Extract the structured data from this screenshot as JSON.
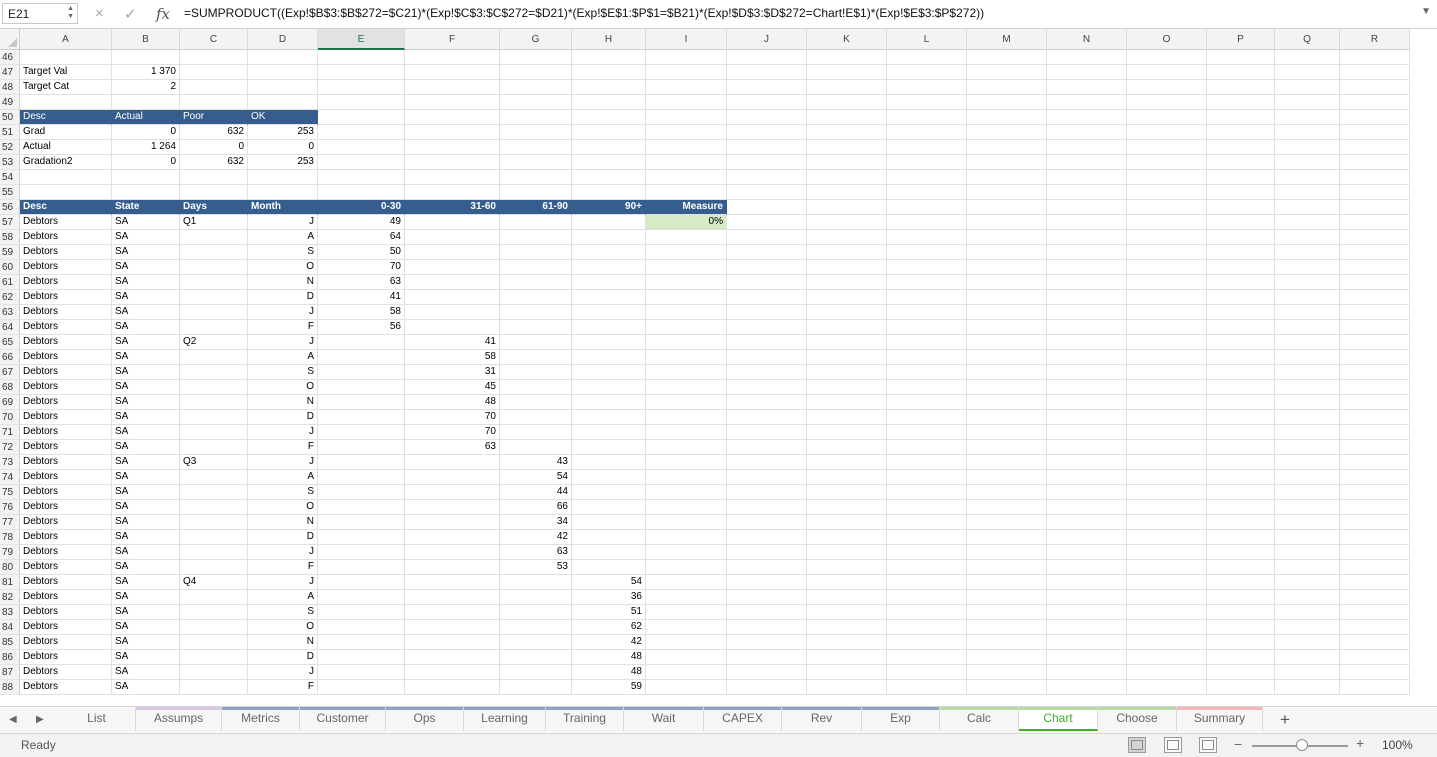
{
  "formula_bar": {
    "name_box": "E21",
    "cancel_icon": "×",
    "enter_icon": "✓",
    "fx_label": "fx",
    "formula": "=SUMPRODUCT((Exp!$B$3:$B$272=$C21)*(Exp!$C$3:$C$272=$D21)*(Exp!$E$1:$P$1=$B21)*(Exp!$D$3:$D$272=Chart!E$1)*(Exp!$E$3:$P$272))"
  },
  "columns": [
    "A",
    "B",
    "C",
    "D",
    "E",
    "F",
    "G",
    "H",
    "I",
    "J",
    "K",
    "L",
    "M",
    "N",
    "O",
    "P",
    "Q",
    "R"
  ],
  "selected_column": "E",
  "rows": [
    {
      "n": "46",
      "cells": []
    },
    {
      "n": "47",
      "cells": [
        {
          "col": "A",
          "v": "Target Val"
        },
        {
          "col": "B",
          "v": "1 370",
          "num": true
        }
      ]
    },
    {
      "n": "48",
      "cells": [
        {
          "col": "A",
          "v": "Target Cat"
        },
        {
          "col": "B",
          "v": "2",
          "num": true
        }
      ]
    },
    {
      "n": "49",
      "cells": []
    },
    {
      "n": "50",
      "cells": [
        {
          "col": "A",
          "v": "Desc",
          "style": "hdr2"
        },
        {
          "col": "B",
          "v": "Actual",
          "style": "hdr2"
        },
        {
          "col": "C",
          "v": "Poor",
          "style": "hdr2"
        },
        {
          "col": "D",
          "v": "OK",
          "style": "hdr2"
        }
      ]
    },
    {
      "n": "51",
      "cells": [
        {
          "col": "A",
          "v": "Grad"
        },
        {
          "col": "B",
          "v": "0",
          "num": true
        },
        {
          "col": "C",
          "v": "632",
          "num": true
        },
        {
          "col": "D",
          "v": "253",
          "num": true
        }
      ]
    },
    {
      "n": "52",
      "cells": [
        {
          "col": "A",
          "v": "Actual"
        },
        {
          "col": "B",
          "v": "1 264",
          "num": true
        },
        {
          "col": "C",
          "v": "0",
          "num": true
        },
        {
          "col": "D",
          "v": "0",
          "num": true
        }
      ]
    },
    {
      "n": "53",
      "cells": [
        {
          "col": "A",
          "v": "Gradation2"
        },
        {
          "col": "B",
          "v": "0",
          "num": true
        },
        {
          "col": "C",
          "v": "632",
          "num": true
        },
        {
          "col": "D",
          "v": "253",
          "num": true
        }
      ]
    },
    {
      "n": "54",
      "cells": []
    },
    {
      "n": "55",
      "cells": []
    },
    {
      "n": "56",
      "cells": [
        {
          "col": "A",
          "v": "Desc",
          "style": "hdr"
        },
        {
          "col": "B",
          "v": "State",
          "style": "hdr"
        },
        {
          "col": "C",
          "v": "Days",
          "style": "hdr"
        },
        {
          "col": "D",
          "v": "Month",
          "style": "hdr"
        },
        {
          "col": "E",
          "v": "0-30",
          "style": "hdr",
          "num": true
        },
        {
          "col": "F",
          "v": "31-60",
          "style": "hdr",
          "num": true
        },
        {
          "col": "G",
          "v": "61-90",
          "style": "hdr",
          "num": true
        },
        {
          "col": "H",
          "v": "90+",
          "style": "hdr",
          "num": true
        },
        {
          "col": "I",
          "v": "Measure",
          "style": "hdr",
          "num": true
        }
      ]
    },
    {
      "n": "57",
      "cells": [
        {
          "col": "A",
          "v": "Debtors"
        },
        {
          "col": "B",
          "v": "SA"
        },
        {
          "col": "C",
          "v": "Q1"
        },
        {
          "col": "D",
          "v": "J",
          "num": true
        },
        {
          "col": "E",
          "v": "49",
          "num": true
        },
        {
          "col": "I",
          "v": "0%",
          "num": true,
          "style": "meas"
        }
      ]
    },
    {
      "n": "58",
      "cells": [
        {
          "col": "A",
          "v": "Debtors"
        },
        {
          "col": "B",
          "v": "SA"
        },
        {
          "col": "D",
          "v": "A",
          "num": true
        },
        {
          "col": "E",
          "v": "64",
          "num": true
        }
      ]
    },
    {
      "n": "59",
      "cells": [
        {
          "col": "A",
          "v": "Debtors"
        },
        {
          "col": "B",
          "v": "SA"
        },
        {
          "col": "D",
          "v": "S",
          "num": true
        },
        {
          "col": "E",
          "v": "50",
          "num": true
        }
      ]
    },
    {
      "n": "60",
      "cells": [
        {
          "col": "A",
          "v": "Debtors"
        },
        {
          "col": "B",
          "v": "SA"
        },
        {
          "col": "D",
          "v": "O",
          "num": true
        },
        {
          "col": "E",
          "v": "70",
          "num": true
        }
      ]
    },
    {
      "n": "61",
      "cells": [
        {
          "col": "A",
          "v": "Debtors"
        },
        {
          "col": "B",
          "v": "SA"
        },
        {
          "col": "D",
          "v": "N",
          "num": true
        },
        {
          "col": "E",
          "v": "63",
          "num": true
        }
      ]
    },
    {
      "n": "62",
      "cells": [
        {
          "col": "A",
          "v": "Debtors"
        },
        {
          "col": "B",
          "v": "SA"
        },
        {
          "col": "D",
          "v": "D",
          "num": true
        },
        {
          "col": "E",
          "v": "41",
          "num": true
        }
      ]
    },
    {
      "n": "63",
      "cells": [
        {
          "col": "A",
          "v": "Debtors"
        },
        {
          "col": "B",
          "v": "SA"
        },
        {
          "col": "D",
          "v": "J",
          "num": true
        },
        {
          "col": "E",
          "v": "58",
          "num": true
        }
      ]
    },
    {
      "n": "64",
      "cells": [
        {
          "col": "A",
          "v": "Debtors"
        },
        {
          "col": "B",
          "v": "SA"
        },
        {
          "col": "D",
          "v": "F",
          "num": true
        },
        {
          "col": "E",
          "v": "56",
          "num": true
        }
      ]
    },
    {
      "n": "65",
      "cells": [
        {
          "col": "A",
          "v": "Debtors"
        },
        {
          "col": "B",
          "v": "SA"
        },
        {
          "col": "C",
          "v": "Q2"
        },
        {
          "col": "D",
          "v": "J",
          "num": true
        },
        {
          "col": "F",
          "v": "41",
          "num": true
        }
      ]
    },
    {
      "n": "66",
      "cells": [
        {
          "col": "A",
          "v": "Debtors"
        },
        {
          "col": "B",
          "v": "SA"
        },
        {
          "col": "D",
          "v": "A",
          "num": true
        },
        {
          "col": "F",
          "v": "58",
          "num": true
        }
      ]
    },
    {
      "n": "67",
      "cells": [
        {
          "col": "A",
          "v": "Debtors"
        },
        {
          "col": "B",
          "v": "SA"
        },
        {
          "col": "D",
          "v": "S",
          "num": true
        },
        {
          "col": "F",
          "v": "31",
          "num": true
        }
      ]
    },
    {
      "n": "68",
      "cells": [
        {
          "col": "A",
          "v": "Debtors"
        },
        {
          "col": "B",
          "v": "SA"
        },
        {
          "col": "D",
          "v": "O",
          "num": true
        },
        {
          "col": "F",
          "v": "45",
          "num": true
        }
      ]
    },
    {
      "n": "69",
      "cells": [
        {
          "col": "A",
          "v": "Debtors"
        },
        {
          "col": "B",
          "v": "SA"
        },
        {
          "col": "D",
          "v": "N",
          "num": true
        },
        {
          "col": "F",
          "v": "48",
          "num": true
        }
      ]
    },
    {
      "n": "70",
      "cells": [
        {
          "col": "A",
          "v": "Debtors"
        },
        {
          "col": "B",
          "v": "SA"
        },
        {
          "col": "D",
          "v": "D",
          "num": true
        },
        {
          "col": "F",
          "v": "70",
          "num": true
        }
      ]
    },
    {
      "n": "71",
      "cells": [
        {
          "col": "A",
          "v": "Debtors"
        },
        {
          "col": "B",
          "v": "SA"
        },
        {
          "col": "D",
          "v": "J",
          "num": true
        },
        {
          "col": "F",
          "v": "70",
          "num": true
        }
      ]
    },
    {
      "n": "72",
      "cells": [
        {
          "col": "A",
          "v": "Debtors"
        },
        {
          "col": "B",
          "v": "SA"
        },
        {
          "col": "D",
          "v": "F",
          "num": true
        },
        {
          "col": "F",
          "v": "63",
          "num": true
        }
      ]
    },
    {
      "n": "73",
      "cells": [
        {
          "col": "A",
          "v": "Debtors"
        },
        {
          "col": "B",
          "v": "SA"
        },
        {
          "col": "C",
          "v": "Q3"
        },
        {
          "col": "D",
          "v": "J",
          "num": true
        },
        {
          "col": "G",
          "v": "43",
          "num": true
        }
      ]
    },
    {
      "n": "74",
      "cells": [
        {
          "col": "A",
          "v": "Debtors"
        },
        {
          "col": "B",
          "v": "SA"
        },
        {
          "col": "D",
          "v": "A",
          "num": true
        },
        {
          "col": "G",
          "v": "54",
          "num": true
        }
      ]
    },
    {
      "n": "75",
      "cells": [
        {
          "col": "A",
          "v": "Debtors"
        },
        {
          "col": "B",
          "v": "SA"
        },
        {
          "col": "D",
          "v": "S",
          "num": true
        },
        {
          "col": "G",
          "v": "44",
          "num": true
        }
      ]
    },
    {
      "n": "76",
      "cells": [
        {
          "col": "A",
          "v": "Debtors"
        },
        {
          "col": "B",
          "v": "SA"
        },
        {
          "col": "D",
          "v": "O",
          "num": true
        },
        {
          "col": "G",
          "v": "66",
          "num": true
        }
      ]
    },
    {
      "n": "77",
      "cells": [
        {
          "col": "A",
          "v": "Debtors"
        },
        {
          "col": "B",
          "v": "SA"
        },
        {
          "col": "D",
          "v": "N",
          "num": true
        },
        {
          "col": "G",
          "v": "34",
          "num": true
        }
      ]
    },
    {
      "n": "78",
      "cells": [
        {
          "col": "A",
          "v": "Debtors"
        },
        {
          "col": "B",
          "v": "SA"
        },
        {
          "col": "D",
          "v": "D",
          "num": true
        },
        {
          "col": "G",
          "v": "42",
          "num": true
        }
      ]
    },
    {
      "n": "79",
      "cells": [
        {
          "col": "A",
          "v": "Debtors"
        },
        {
          "col": "B",
          "v": "SA"
        },
        {
          "col": "D",
          "v": "J",
          "num": true
        },
        {
          "col": "G",
          "v": "63",
          "num": true
        }
      ]
    },
    {
      "n": "80",
      "cells": [
        {
          "col": "A",
          "v": "Debtors"
        },
        {
          "col": "B",
          "v": "SA"
        },
        {
          "col": "D",
          "v": "F",
          "num": true
        },
        {
          "col": "G",
          "v": "53",
          "num": true
        }
      ]
    },
    {
      "n": "81",
      "cells": [
        {
          "col": "A",
          "v": "Debtors"
        },
        {
          "col": "B",
          "v": "SA"
        },
        {
          "col": "C",
          "v": "Q4"
        },
        {
          "col": "D",
          "v": "J",
          "num": true
        },
        {
          "col": "H",
          "v": "54",
          "num": true
        }
      ]
    },
    {
      "n": "82",
      "cells": [
        {
          "col": "A",
          "v": "Debtors"
        },
        {
          "col": "B",
          "v": "SA"
        },
        {
          "col": "D",
          "v": "A",
          "num": true
        },
        {
          "col": "H",
          "v": "36",
          "num": true
        }
      ]
    },
    {
      "n": "83",
      "cells": [
        {
          "col": "A",
          "v": "Debtors"
        },
        {
          "col": "B",
          "v": "SA"
        },
        {
          "col": "D",
          "v": "S",
          "num": true
        },
        {
          "col": "H",
          "v": "51",
          "num": true
        }
      ]
    },
    {
      "n": "84",
      "cells": [
        {
          "col": "A",
          "v": "Debtors"
        },
        {
          "col": "B",
          "v": "SA"
        },
        {
          "col": "D",
          "v": "O",
          "num": true
        },
        {
          "col": "H",
          "v": "62",
          "num": true
        }
      ]
    },
    {
      "n": "85",
      "cells": [
        {
          "col": "A",
          "v": "Debtors"
        },
        {
          "col": "B",
          "v": "SA"
        },
        {
          "col": "D",
          "v": "N",
          "num": true
        },
        {
          "col": "H",
          "v": "42",
          "num": true
        }
      ]
    },
    {
      "n": "86",
      "cells": [
        {
          "col": "A",
          "v": "Debtors"
        },
        {
          "col": "B",
          "v": "SA"
        },
        {
          "col": "D",
          "v": "D",
          "num": true
        },
        {
          "col": "H",
          "v": "48",
          "num": true
        }
      ]
    },
    {
      "n": "87",
      "cells": [
        {
          "col": "A",
          "v": "Debtors"
        },
        {
          "col": "B",
          "v": "SA"
        },
        {
          "col": "D",
          "v": "J",
          "num": true
        },
        {
          "col": "H",
          "v": "48",
          "num": true
        }
      ]
    },
    {
      "n": "88",
      "cells": [
        {
          "col": "A",
          "v": "Debtors"
        },
        {
          "col": "B",
          "v": "SA"
        },
        {
          "col": "D",
          "v": "F",
          "num": true
        },
        {
          "col": "H",
          "v": "59",
          "num": true
        }
      ]
    }
  ],
  "colors": {
    "header_fill": "#355e8f",
    "measure_fill": "#d4ebc6",
    "active_tab": "#3fae2a"
  },
  "sheet_tabs": [
    {
      "label": "List",
      "color": ""
    },
    {
      "label": "Assumps",
      "color": "#d9c6e0"
    },
    {
      "label": "Metrics",
      "color": "#8ea4bf"
    },
    {
      "label": "Customer",
      "color": "#8ea4bf"
    },
    {
      "label": "Ops",
      "color": "#8ea4bf"
    },
    {
      "label": "Learning",
      "color": "#8ea4bf"
    },
    {
      "label": "Training",
      "color": "#8ea4bf"
    },
    {
      "label": "Wait",
      "color": "#8ea4bf"
    },
    {
      "label": "CAPEX",
      "color": "#8ea4bf"
    },
    {
      "label": "Rev",
      "color": "#8ea4bf"
    },
    {
      "label": "Exp",
      "color": "#8ea4bf"
    },
    {
      "label": "Calc",
      "color": "#b5dca3"
    },
    {
      "label": "Chart",
      "color": "#b5dca3",
      "active": true
    },
    {
      "label": "Choose",
      "color": "#b5dca3"
    },
    {
      "label": "Summary",
      "color": "#f2b8b8"
    }
  ],
  "add_sheet_label": "+",
  "status_bar": {
    "status": "Ready",
    "zoom_minus": "−",
    "zoom_plus": "+",
    "zoom": "100%",
    "zoom_level_percent": 100
  }
}
